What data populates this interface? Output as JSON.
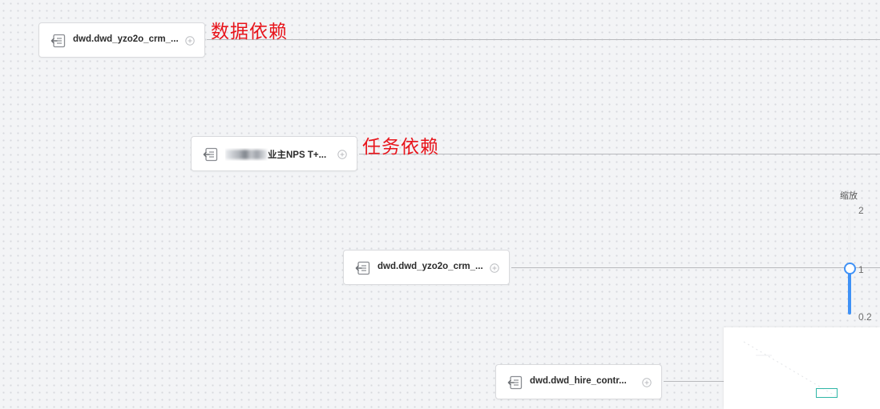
{
  "annotations": {
    "data_dependency": "数据依赖",
    "task_dependency": "任务依赖"
  },
  "nodes": [
    {
      "label": "dwd.dwd_yzo2o_crm_...",
      "icon": "table-import-icon"
    },
    {
      "label": "业主NPS T+...",
      "icon": "table-import-icon",
      "redacted_prefix": true
    },
    {
      "label": "dwd.dwd_yzo2o_crm_...",
      "icon": "table-import-icon"
    },
    {
      "label": "dwd.dwd_hire_contr...",
      "icon": "table-import-icon"
    }
  ],
  "zoom": {
    "title": "缩放",
    "max": "2",
    "current": "1",
    "min": "0.2",
    "value": 1,
    "accent": "#3f91f6"
  },
  "minimap": {
    "viewport_color": "#2fb6a6"
  }
}
